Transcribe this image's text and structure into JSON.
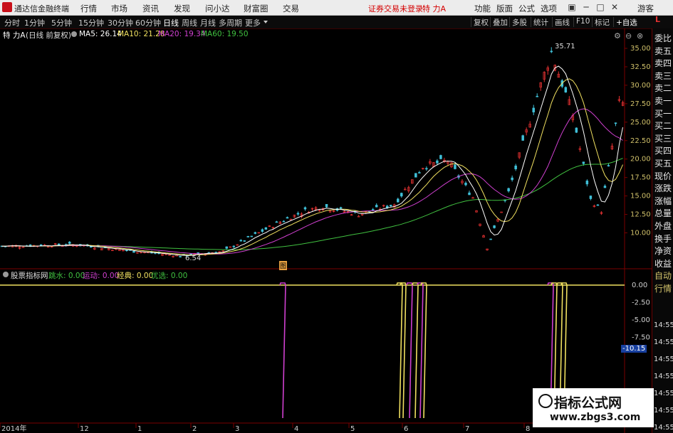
{
  "menubar": {
    "app_title": "通达信金融终端",
    "menus": [
      "行情",
      "市场",
      "资讯",
      "发现",
      "问小达",
      "财富圈",
      "交易"
    ],
    "warning": "证券交易未登录",
    "stock": "特 力A",
    "right_items": [
      "功能",
      "版面",
      "公式",
      "选项"
    ],
    "guest": "游客"
  },
  "periodbar": {
    "periods": [
      "分时",
      "1分钟",
      "5分钟",
      "15分钟",
      "30分钟",
      "60分钟",
      "日线",
      "周线",
      "月线",
      "多周期",
      "更多"
    ],
    "active_period": "日线",
    "toolbar": [
      "复权",
      "叠加",
      "多股",
      "统计",
      "画线",
      "F10",
      "标记",
      "+自选"
    ]
  },
  "main_chart": {
    "title": "特 力A",
    "adjust": "(日线 前复权)",
    "ma_legend": [
      {
        "label": "MA5: 26.14",
        "color": "#ffffff"
      },
      {
        "label": "MA10: 21.28",
        "color": "#f0e060"
      },
      {
        "label": "MA20: 19.34",
        "color": "#d040d0"
      },
      {
        "label": "MA60: 19.50",
        "color": "#40c040"
      }
    ],
    "high_label": "35.71",
    "low_label": "6.54",
    "event_marker": "图",
    "y_ticks": [
      "35.00",
      "32.50",
      "30.00",
      "27.50",
      "25.00",
      "22.50",
      "20.00",
      "17.50",
      "15.00",
      "12.50",
      "10.00"
    ]
  },
  "sub_chart": {
    "name": "股票指标网",
    "legend": [
      {
        "label": "跳水: 0.00",
        "color": "#40c040"
      },
      {
        "label": "运动: 0.00",
        "color": "#d040d0"
      },
      {
        "label": "经典: 0.00",
        "color": "#f0e060"
      },
      {
        "label": "优选: 0.00",
        "color": "#40c040"
      }
    ],
    "y_ticks": [
      "0.00",
      "-2.50",
      "-5.00",
      "-7.50",
      "-10.15"
    ],
    "current_value": "-10.15"
  },
  "right_panel": {
    "top_letter": "L",
    "items": [
      "委比",
      "卖五",
      "卖四",
      "卖三",
      "卖二",
      "卖一",
      "买一",
      "买二",
      "买三",
      "买四",
      "买五",
      "现价",
      "涨跌",
      "涨幅",
      "总量",
      "外盘",
      "换手",
      "净资",
      "收益",
      "自动",
      "行情"
    ],
    "times": [
      "14:55",
      "14:55",
      "14:55",
      "14:55",
      "14:55",
      "14:55",
      "14:55"
    ]
  },
  "x_axis": {
    "labels": [
      "2014年",
      "12",
      "1",
      "2",
      "3",
      "4",
      "5",
      "6",
      "7",
      "8"
    ]
  },
  "watermark": {
    "line1": "指标公式网",
    "line2": "www.zbgs3.com"
  },
  "colors": {
    "up": "#e03030",
    "down": "#40c0d8",
    "ma5": "#ffffff",
    "ma10": "#f0e060",
    "ma20": "#d040d0",
    "ma60": "#40c040",
    "panel_border": "#6a0000"
  }
}
